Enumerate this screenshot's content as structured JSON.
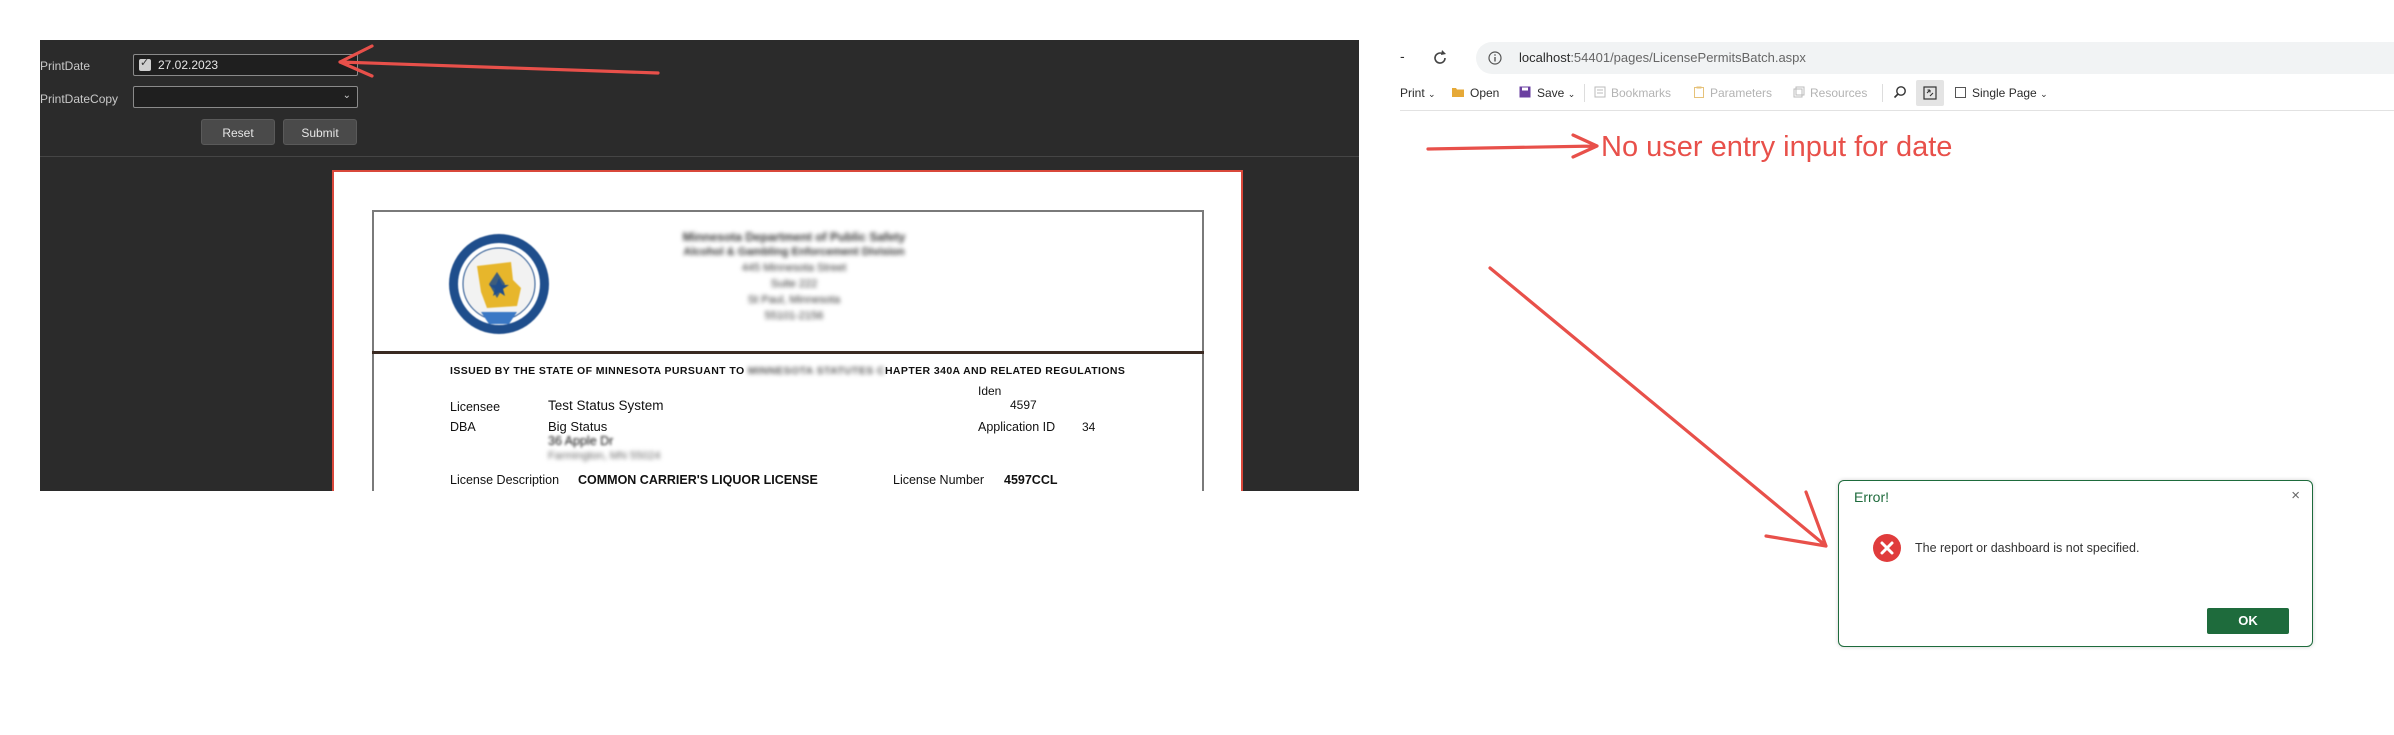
{
  "left_panel": {
    "params": [
      {
        "label": "PrintDate",
        "value": "27.02.2023",
        "checked": true
      },
      {
        "label": "PrintDateCopy",
        "value": ""
      }
    ],
    "buttons": {
      "reset": "Reset",
      "submit": "Submit"
    },
    "report": {
      "header_lines": [
        "Minnesota Department of Public Safety",
        "Alcohol & Gambling Enforcement Division",
        "445 Minnesota Street",
        "Suite 222",
        "St Paul, Minnesota",
        "55101-2156"
      ],
      "issued_line": {
        "prefix": "ISSUED BY THE STATE OF MINNESOTA PURSUANT TO",
        "blurred": "MINNESOTA STATUTES C",
        "suffix": "HAPTER 340A AND RELATED REGULATIONS"
      },
      "fields": {
        "iden_label": "Iden",
        "iden_value": "4597",
        "licensee_label": "Licensee",
        "licensee_value": "Test Status System",
        "dba_label": "DBA",
        "dba_value": "Big Status",
        "address_line1": "36 Apple Dr",
        "address_line2": "Farmington, MN 55024",
        "application_id_label": "Application ID",
        "application_id_value": "34",
        "license_description_label": "License Description",
        "license_description_value": "COMMON CARRIER'S LIQUOR LICENSE",
        "license_number_label": "License Number",
        "license_number_value": "4597CCL"
      },
      "seal_text": "DEPARTMENT OF PUBLIC SAFETY"
    }
  },
  "browser": {
    "url_host": "localhost",
    "url_rest": ":54401/pages/LicensePermitsBatch.aspx",
    "toolbar": {
      "print": "Print",
      "open": "Open",
      "save": "Save",
      "bookmarks": "Bookmarks",
      "parameters": "Parameters",
      "resources": "Resources",
      "single_page": "Single Page"
    }
  },
  "annotation": {
    "text": "No user entry input for date",
    "color": "#e8504a"
  },
  "error_dialog": {
    "title": "Error!",
    "message": "The report or dashboard is not specified.",
    "ok": "OK"
  },
  "colors": {
    "accent_green": "#1e6b3c",
    "error_red": "#e03c3c",
    "arrow_red": "#e8504a"
  },
  "icons": [
    "chevron-down-icon",
    "refresh-icon",
    "info-icon",
    "folder-icon",
    "save-icon",
    "bookmark-icon",
    "parameters-icon",
    "resources-icon",
    "search-icon",
    "fit-page-icon",
    "close-icon",
    "error-icon"
  ]
}
